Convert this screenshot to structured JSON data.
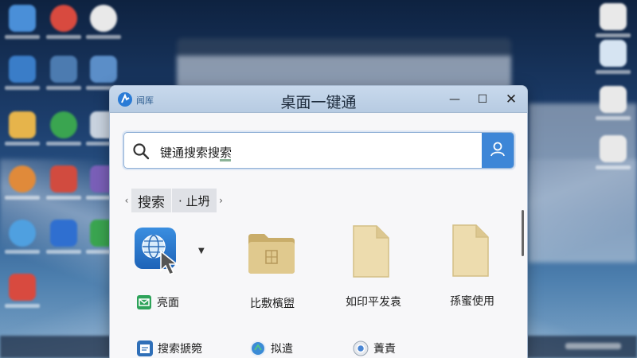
{
  "window": {
    "app_name": "闻厍",
    "title": "桌面一键通",
    "controls": {
      "minimize": "—",
      "maximize": "☐",
      "close": "✕"
    }
  },
  "search": {
    "query": "键通搜索搜索",
    "icon": "search-icon",
    "action_icon": "user-icon"
  },
  "tabs": {
    "prev_arrow": "‹",
    "next_arrow": "›",
    "items": [
      {
        "label": "搜索"
      },
      {
        "label": "· 止坍"
      }
    ]
  },
  "items": [
    {
      "label": "亮面",
      "icon": "globe-app-icon"
    },
    {
      "label": "比敷檳盥",
      "icon": "folder-icon"
    },
    {
      "label": "如印平发袁",
      "icon": "document-icon"
    },
    {
      "label": "孫蜜使用",
      "icon": "document-icon"
    }
  ],
  "items_row2": [
    {
      "label": "搜索搋箢",
      "icon": "calendar-icon"
    },
    {
      "label": "拟遣",
      "icon": "app-icon"
    },
    {
      "label": "蔶責",
      "icon": "chrome-icon"
    }
  ],
  "colors": {
    "accent": "#3d86d7",
    "titlebar": "#c8d9ec",
    "folder": "#e0c98e",
    "document": "#eddcae"
  }
}
